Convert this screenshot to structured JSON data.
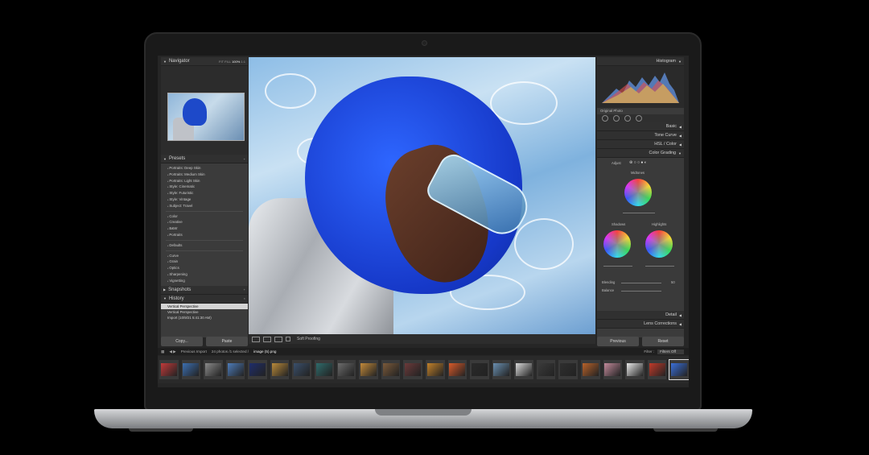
{
  "navigator": {
    "title": "Navigator",
    "zoom": [
      "FIT",
      "FILL",
      "100%",
      "1:1"
    ]
  },
  "presets": {
    "title": "Presets",
    "group1": [
      "Portraits: Deep Skin",
      "Portraits: Medium Skin",
      "Portraits: Light Skin",
      "Style: Cinematic",
      "Style: Futuristic",
      "Style: Vintage",
      "Subject: Travel"
    ],
    "group2": [
      "Color",
      "Creative",
      "B&W",
      "Portraits"
    ],
    "group3": [
      "Defaults"
    ],
    "group4": [
      "Curve",
      "Grain",
      "Optics",
      "Sharpening",
      "Vignetting"
    ]
  },
  "snapshots": {
    "title": "Snapshots"
  },
  "history": {
    "title": "History",
    "rows": [
      "Vertical Perspective",
      "Vertical Perspective",
      "Import (10/9/21 5:41:30 AM)"
    ]
  },
  "left_buttons": {
    "copy": "Copy...",
    "paste": "Paste"
  },
  "toolbar": {
    "soft_proofing": "Soft Proofing"
  },
  "right": {
    "histogram": "Histogram",
    "original_photo": "Original Photo",
    "basic": "Basic",
    "tone_curve": "Tone Curve",
    "hsl": "HSL / Color",
    "color_grading": "Color Grading",
    "adjust": "Adjust",
    "midtones": "Midtones",
    "shadows": "Shadows",
    "highlights": "Highlights",
    "blending": "Blending",
    "blending_value": "50",
    "balance": "Balance",
    "detail": "Detail",
    "lens_corrections": "Lens Corrections",
    "previous": "Previous",
    "reset": "Reset"
  },
  "filmstrip": {
    "previous_import": "Previous Import",
    "count": "24 photos /1 selected /",
    "selected_file": "image (5).png",
    "filter_label": "Filter :",
    "filter_value": "Filters Off",
    "thumb_colors": [
      "#c23a3a",
      "#3c6fb0",
      "#8a8a8a",
      "#4d7bb8",
      "#1e2d6b",
      "#b98a3a",
      "#3a4f6b",
      "#2f6b6b",
      "#6b6b6b",
      "#c28a3a",
      "#7b5a3a",
      "#6b3a3a",
      "#c2812a",
      "#d85a2a",
      "#2a2a2a",
      "#6a8fb0",
      "#d8d8d8",
      "#3a3a3a",
      "#2f2f2f",
      "#b8622a",
      "#c28a9a",
      "#e8e8e8",
      "#c23a2a",
      "#3a6fd8"
    ]
  }
}
